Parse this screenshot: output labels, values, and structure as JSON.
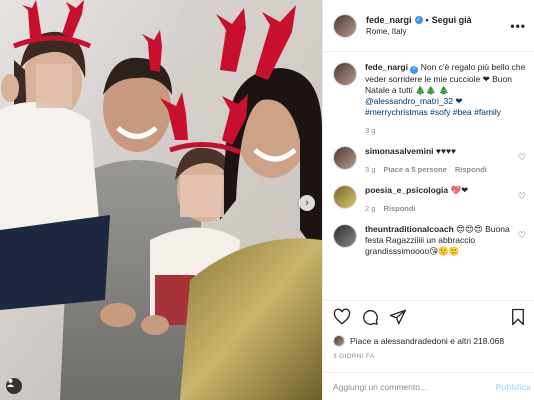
{
  "post": {
    "username": "fede_nargi",
    "follow_label": "Segui già",
    "location": "Rome, Italy",
    "more_label": "•••"
  },
  "caption": {
    "username": "fede_nargi",
    "text_part1": "Non c'è regalo più bello che veder sorridere le mie cucciole ❤ Buon Natale a tutti 🎄🎄",
    "text_part2": "🎄 @alessandro_matri_32 ❤",
    "hashtags": "#merrychristmas #sofy #bea #family",
    "time": "3 g"
  },
  "comments": [
    {
      "username": "simonasalvemini",
      "text": "♥♥♥♥",
      "time": "3 g",
      "likes": "Piace a 5 persone",
      "reply": "Rispondi"
    },
    {
      "username": "poesia_e_psicologia",
      "text": "💖❤",
      "time": "2 g",
      "likes": "",
      "reply": "Rispondi"
    },
    {
      "username": "theuntraditionalcoach",
      "text": "😍😍😍 Buona festa Ragazziiiii un abbraccio grandisssimoooo😘🙂🙂",
      "time": "",
      "likes": "",
      "reply": ""
    }
  ],
  "actions": {
    "likes_text": "Piace a alessandradedoni e altri 218.068",
    "date": "3 GIORNI FA"
  },
  "add_comment": {
    "placeholder": "Aggiungi un commento...",
    "publish_label": "Pubblica"
  },
  "colors": {
    "verified": "#3897f0",
    "mention": "#00376b",
    "publish": "#b2dffc",
    "reindeer_antlers": "#c8102e"
  },
  "icons": [
    "heart-icon",
    "comment-icon",
    "share-icon",
    "bookmark-icon",
    "next-arrow-icon",
    "tag-user-icon",
    "verified-badge-icon",
    "more-options-icon"
  ]
}
